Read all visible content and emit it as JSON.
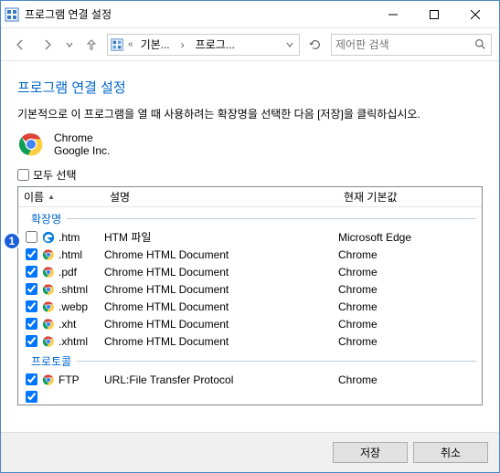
{
  "window": {
    "title": "프로그램 연결 설정"
  },
  "breadcrumb": {
    "seg1": "기본...",
    "seg2": "프로그...",
    "chev_label": "›"
  },
  "search": {
    "placeholder": "제어판 검색"
  },
  "page": {
    "title": "프로그램 연결 설정",
    "description": "기본적으로 이 프로그램을 열 때 사용하려는 확장명을 선택한 다음 [저장]을 클릭하십시오."
  },
  "app": {
    "name": "Chrome",
    "publisher": "Google Inc."
  },
  "select_all_label": "모두 선택",
  "columns": {
    "name": "이름",
    "desc": "설명",
    "default": "현재 기본값"
  },
  "groups": {
    "ext": "확장명",
    "proto": "프로토콜"
  },
  "rows": [
    {
      "checked": false,
      "icon": "edge",
      "ext": ".htm",
      "desc": "HTM 파일",
      "def": "Microsoft Edge"
    },
    {
      "checked": true,
      "icon": "chrome",
      "ext": ".html",
      "desc": "Chrome HTML Document",
      "def": "Chrome"
    },
    {
      "checked": true,
      "icon": "chrome",
      "ext": ".pdf",
      "desc": "Chrome HTML Document",
      "def": "Chrome"
    },
    {
      "checked": true,
      "icon": "chrome",
      "ext": ".shtml",
      "desc": "Chrome HTML Document",
      "def": "Chrome"
    },
    {
      "checked": true,
      "icon": "chrome",
      "ext": ".webp",
      "desc": "Chrome HTML Document",
      "def": "Chrome"
    },
    {
      "checked": true,
      "icon": "chrome",
      "ext": ".xht",
      "desc": "Chrome HTML Document",
      "def": "Chrome"
    },
    {
      "checked": true,
      "icon": "chrome",
      "ext": ".xhtml",
      "desc": "Chrome HTML Document",
      "def": "Chrome"
    }
  ],
  "proto_rows": [
    {
      "checked": true,
      "icon": "chrome",
      "ext": "FTP",
      "desc": "URL:File Transfer Protocol",
      "def": "Chrome"
    }
  ],
  "buttons": {
    "save": "저장",
    "cancel": "취소"
  },
  "callout": "1"
}
